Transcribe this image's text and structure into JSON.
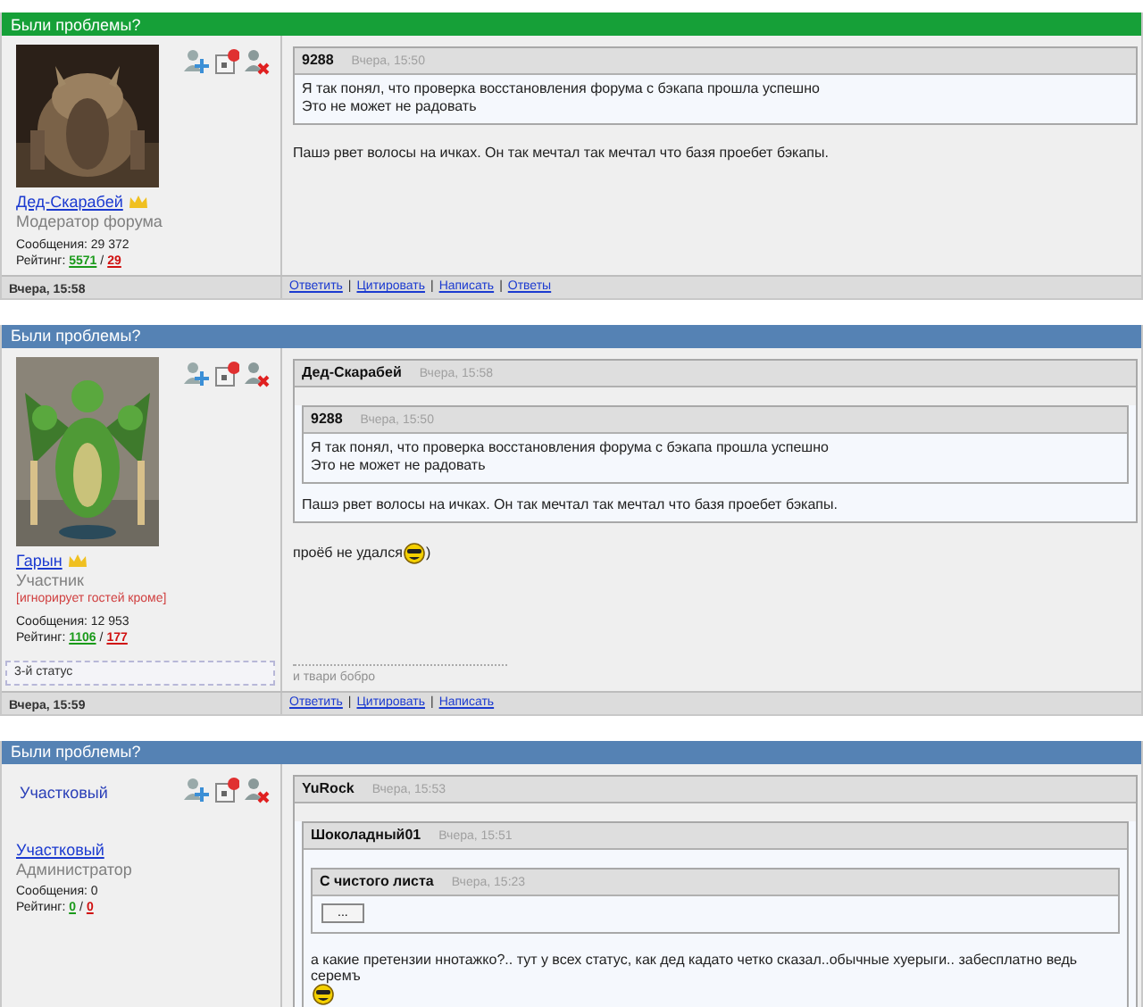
{
  "posts": [
    {
      "title": "Были проблемы?",
      "color": "#16a038",
      "author": {
        "name": "Дед-Скарабей",
        "crown": true,
        "role": "Модератор форума",
        "messages": "Сообщения: 29 372",
        "rating": {
          "label": "Рейтинг:",
          "plus": "5571",
          "separator": "/",
          "minus": "29"
        }
      },
      "body": [
        {
          "kind": "quote",
          "author": "9288",
          "time": "Вчера, 15:50",
          "body": [
            {
              "kind": "lines",
              "lines": [
                "Я так понял, что проверка восстановления форума с бэкапа прошла успешно",
                "Это не может не радовать"
              ]
            }
          ]
        },
        {
          "kind": "paragraph",
          "parts": [
            {
              "kind": "text",
              "text": "Пашэ рвет волосы на ичках. Он так мечтал так мечтал что базя проебет бэкапы."
            }
          ]
        }
      ],
      "footer": {
        "time": "Вчера, 15:58",
        "links": [
          "Ответить",
          "Цитировать",
          "Написать",
          "Ответы"
        ],
        "link_separator": "|"
      }
    },
    {
      "title": "Были проблемы?",
      "color": "#5582b4",
      "author": {
        "name": "Гарын",
        "crown": true,
        "role": "Участник",
        "note": "[игнорирует гостей кроме]",
        "messages": "Сообщения: 12 953",
        "rating": {
          "label": "Рейтинг:",
          "plus": "1106",
          "separator": "/",
          "minus": "177"
        },
        "status": "3-й статус"
      },
      "body": [
        {
          "kind": "quote",
          "author": "Дед-Скарабей",
          "time": "Вчера, 15:58",
          "body": [
            {
              "kind": "quote",
              "author": "9288",
              "time": "Вчера, 15:50",
              "body": [
                {
                  "kind": "lines",
                  "lines": [
                    "Я так понял, что проверка восстановления форума с бэкапа прошла успешно",
                    "Это не может не радовать"
                  ]
                }
              ]
            },
            {
              "kind": "lines",
              "lines": [
                "Пашэ рвет волосы на ичках. Он так мечтал так мечтал что базя проебет бэкапы."
              ]
            }
          ]
        },
        {
          "kind": "paragraph",
          "parts": [
            {
              "kind": "text",
              "text": "проёб не удался"
            },
            {
              "kind": "smiley"
            },
            {
              "kind": "text",
              "text": ")"
            }
          ]
        }
      ],
      "signature": "и твари бобро",
      "footer": {
        "time": "Вчера, 15:59",
        "links": [
          "Ответить",
          "Цитировать",
          "Написать"
        ],
        "link_separator": "|"
      }
    },
    {
      "title": "Были проблемы?",
      "color": "#5582b4",
      "author": {
        "avatar": {
          "kind": "alt_text",
          "text": "Участковый"
        },
        "name": "Участковый",
        "crown": false,
        "role": "Администратор",
        "messages": "Сообщения: 0",
        "rating": {
          "label": "Рейтинг:",
          "plus": "0",
          "separator": "/",
          "minus": "0"
        }
      },
      "body": [
        {
          "kind": "quote",
          "author": "YuRock",
          "time": "Вчера, 15:53",
          "body": [
            {
              "kind": "quote",
              "author": "Шоколадный01",
              "time": "Вчера, 15:51",
              "body": [
                {
                  "kind": "quote",
                  "author": "С чистого листа",
                  "time": "Вчера, 15:23",
                  "body": [
                    {
                      "kind": "button",
                      "label": "..."
                    }
                  ]
                },
                {
                  "kind": "paragraph",
                  "parts": [
                    {
                      "kind": "text",
                      "text": "а какие претензии ннотажко?.. тут у всех статус, как дед кадато четко сказал..обычные хуерыги.. забесплатно ведь серемъ"
                    },
                    {
                      "kind": "smiley"
                    }
                  ]
                }
              ]
            }
          ]
        }
      ]
    }
  ]
}
